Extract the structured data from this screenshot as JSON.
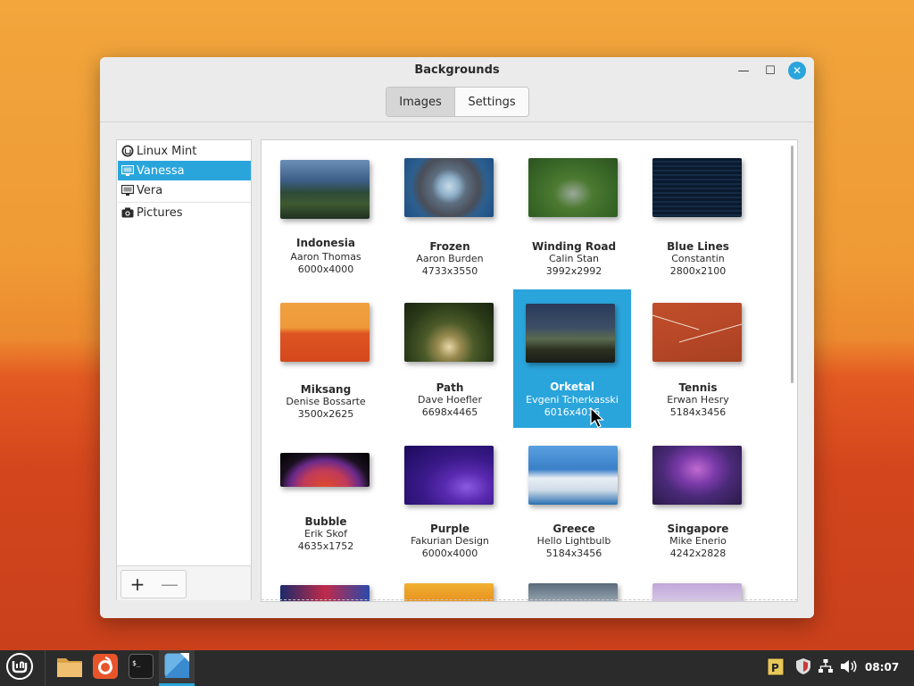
{
  "window": {
    "title": "Backgrounds",
    "tabs": {
      "images": "Images",
      "settings": "Settings"
    },
    "buttons": {
      "minimize": "—",
      "maximize": "☐",
      "close": "✕"
    }
  },
  "sidebar": {
    "items": [
      {
        "label": "Linux Mint",
        "icon": "mint-logo-icon"
      },
      {
        "label": "Vanessa",
        "icon": "monitor-icon"
      },
      {
        "label": "Vera",
        "icon": "monitor-icon"
      },
      {
        "label": "Pictures",
        "icon": "camera-icon"
      }
    ],
    "add_label": "+",
    "remove_label": "—"
  },
  "grid": {
    "items": [
      {
        "name": "Indonesia",
        "author": "Aaron Thomas",
        "size": "6000x4000"
      },
      {
        "name": "Frozen",
        "author": "Aaron Burden",
        "size": "4733x3550"
      },
      {
        "name": "Winding Road",
        "author": "Calin Stan",
        "size": "3992x2992"
      },
      {
        "name": "Blue Lines",
        "author": "Constantin",
        "size": "2800x2100"
      },
      {
        "name": "Miksang",
        "author": "Denise Bossarte",
        "size": "3500x2625"
      },
      {
        "name": "Path",
        "author": "Dave Hoefler",
        "size": "6698x4465"
      },
      {
        "name": "Orketal",
        "author": "Evgeni Tcherkasski",
        "size": "6016x4016"
      },
      {
        "name": "Tennis",
        "author": "Erwan Hesry",
        "size": "5184x3456"
      },
      {
        "name": "Bubble",
        "author": "Erik Skof",
        "size": "4635x1752"
      },
      {
        "name": "Purple",
        "author": "Fakurian Design",
        "size": "6000x4000"
      },
      {
        "name": "Greece",
        "author": "Hello Lightbulb",
        "size": "5184x3456"
      },
      {
        "name": "Singapore",
        "author": "Mike Enerio",
        "size": "4242x2828"
      }
    ]
  },
  "taskbar": {
    "clock": "08:07",
    "apps": [
      "menu-icon",
      "files-icon",
      "firefox-icon",
      "terminal-icon",
      "backgrounds-icon"
    ],
    "tray": [
      "parcellite-icon",
      "shield-icon",
      "network-icon",
      "volume-icon"
    ]
  },
  "colors": {
    "accent": "#2aa5dc",
    "taskbar": "#2b2b2b"
  }
}
